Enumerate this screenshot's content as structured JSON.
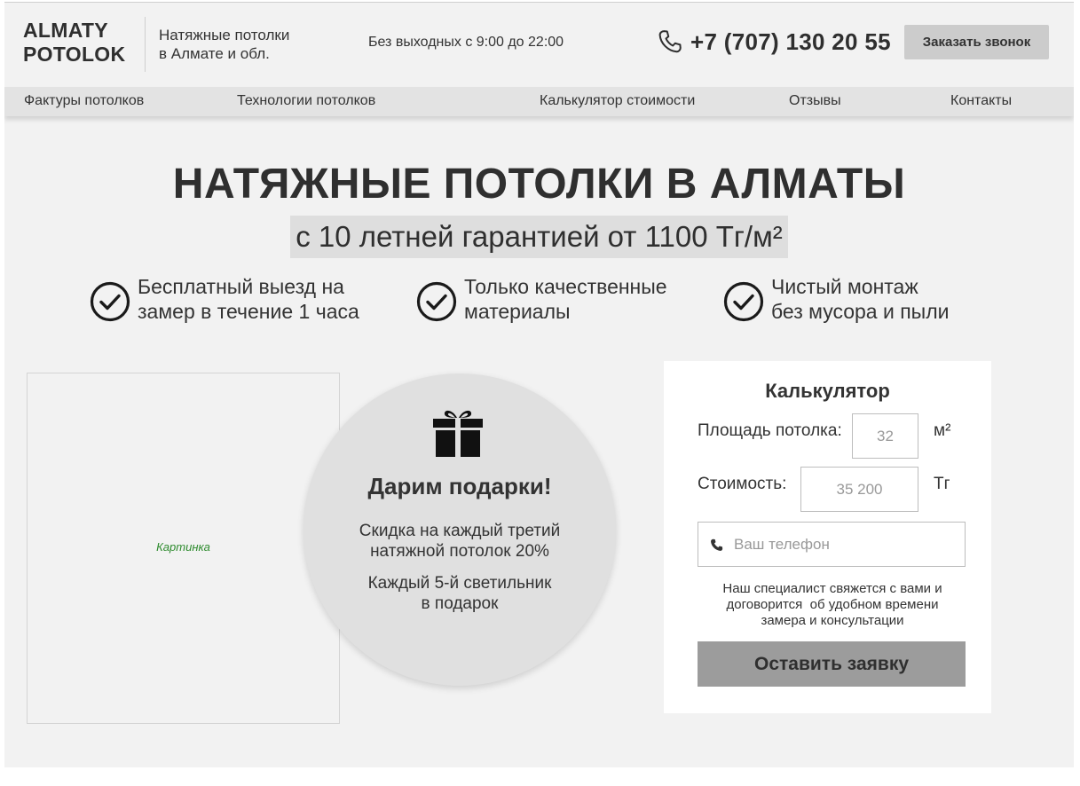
{
  "header": {
    "logo_line1": "ALMATY",
    "logo_line2": "POTOLOK",
    "tagline_line1": "Натяжные потолки",
    "tagline_line2": "в Алмате и обл.",
    "hours": "Без выходных с 9:00 до 22:00",
    "phone": "+7 (707) 130 20 55",
    "phone_icon": "phone-icon",
    "callback_label": "Заказать звонок"
  },
  "nav": {
    "items": [
      {
        "label": "Фактуры потолков"
      },
      {
        "label": "Технологии потолков"
      },
      {
        "label": "Калькулятор стоимости"
      },
      {
        "label": "Отзывы"
      },
      {
        "label": "Контакты"
      }
    ]
  },
  "hero": {
    "title": "НАТЯЖНЫЕ ПОТОЛКИ В АЛМАТЫ",
    "subtitle": "с 10 летней гарантией от 1100 Тг/м²",
    "features": [
      {
        "icon": "check-circle-icon",
        "line1": "Бесплатный выезд на",
        "line2": "замер в течение 1 часа"
      },
      {
        "icon": "check-circle-icon",
        "line1": "Только качественные",
        "line2": "материалы"
      },
      {
        "icon": "check-circle-icon",
        "line1": "Чистый монтаж",
        "line2": "без мусора и пыли"
      }
    ]
  },
  "picture": {
    "label": "Картинка"
  },
  "gift": {
    "icon": "gift-icon",
    "title": "Дарим подарки!",
    "text1_line1": "Скидка на каждый третий",
    "text1_line2": "натяжной потолок 20%",
    "text2_line1": "Каждый 5-й светильник",
    "text2_line2": "в подарок"
  },
  "calculator": {
    "title": "Калькулятор",
    "area_label": "Площадь потолка:",
    "area_value": "32",
    "area_unit": "м²",
    "cost_label": "Стоимость:",
    "cost_value": "35 200",
    "cost_unit": "Тг",
    "phone_placeholder": "Ваш телефон",
    "note_line1": "Наш специалист свяжется с вами и",
    "note_line2": "договорится  об удобном времени",
    "note_line3": "замера и консультации",
    "submit_label": "Оставить заявку"
  },
  "colors": {
    "background": "#f2f2f2",
    "nav_background": "#e3e3e3",
    "button_grey": "#cccccc",
    "submit_grey": "#9c9c9c",
    "text_dark": "#2f2f2f",
    "placeholder_green": "#2e8b2e"
  }
}
